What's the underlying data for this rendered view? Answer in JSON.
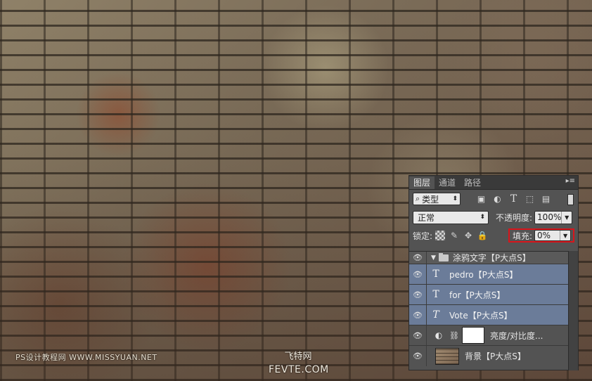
{
  "watermarks": {
    "left": "PS设计教程网 WWW.MISSYUAN.NET",
    "center_top": "飞特网",
    "center_bottom": "FEVTE.COM"
  },
  "panel": {
    "tabs": [
      "图层",
      "通道",
      "路径"
    ],
    "menu_icon": "panel-menu-icon",
    "filter": {
      "label": "类型"
    },
    "blend_mode": "正常",
    "opacity_label": "不透明度:",
    "opacity_value": "100%",
    "lock_label": "锁定:",
    "fill_label": "填充:",
    "fill_value": "0%",
    "highlight_color": "#d8151b",
    "selected_color": "#6b7c99",
    "layers": [
      {
        "name": "涂鸦文字【P大点S】",
        "type": "group"
      },
      {
        "name": "pedro【P大点S】",
        "type": "text",
        "glyph": "T"
      },
      {
        "name": "for【P大点S】",
        "type": "text",
        "glyph": "T"
      },
      {
        "name": "Vote【P大点S】",
        "type": "text",
        "glyph": "T"
      },
      {
        "name": "亮度/对比度...",
        "type": "adjustment"
      },
      {
        "name": "背景【P大点S】",
        "type": "image"
      }
    ]
  }
}
